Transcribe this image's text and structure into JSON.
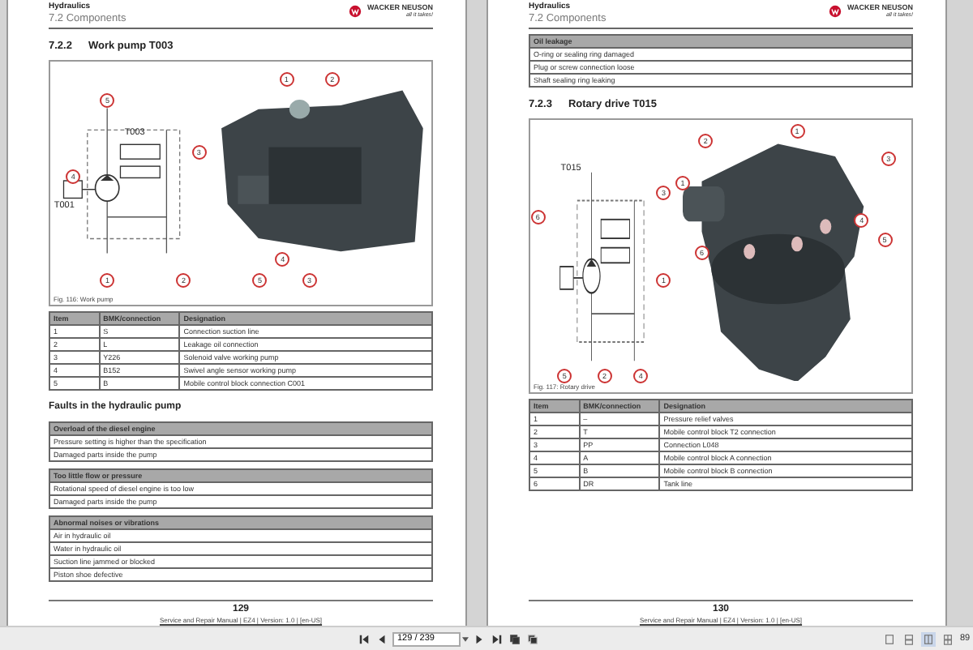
{
  "pages": [
    {
      "running_header": "Hydraulics",
      "section": "7.2 Components",
      "logo": {
        "brand": "WACKER NEUSON",
        "tagline": "all it takes!"
      },
      "blocks": [
        {
          "kind": "heading",
          "number": "7.2.2",
          "title": "Work pump T003"
        },
        {
          "kind": "pump_figure",
          "labels": [
            "T003",
            "T001"
          ],
          "schematic_callouts": [
            "5",
            "3",
            "4",
            "1",
            "2"
          ],
          "photo_callouts": [
            "1",
            "2",
            "4",
            "5",
            "3"
          ],
          "caption": "Fig. 116: Work pump"
        },
        {
          "kind": "parts_table",
          "columns": [
            "Item",
            "BMK/connection",
            "Designation"
          ],
          "rows": [
            [
              "1",
              "S",
              "Connection suction line"
            ],
            [
              "2",
              "L",
              "Leakage oil connection"
            ],
            [
              "3",
              "Y226",
              "Solenoid valve working pump"
            ],
            [
              "4",
              "B152",
              "Swivel angle sensor working pump"
            ],
            [
              "5",
              "B",
              "Mobile control block connection C001"
            ]
          ]
        },
        {
          "kind": "subheading",
          "title": "Faults in the hydraulic pump"
        },
        {
          "kind": "faults",
          "groups": [
            {
              "title": "Overload of the diesel engine",
              "items": [
                "Pressure setting is higher than the specification",
                "Damaged parts inside the pump"
              ]
            },
            {
              "title": "Too little flow or pressure",
              "items": [
                "Rotational speed of diesel engine is too low",
                "Damaged parts inside the pump"
              ]
            },
            {
              "title": "Abnormal noises or vibrations",
              "items": [
                "Air in hydraulic oil",
                "Water in hydraulic oil",
                "Suction line jammed or blocked",
                "Piston shoe defective"
              ]
            }
          ]
        }
      ],
      "page_number": "129",
      "footer": "Service and Repair Manual | EZ4 | Version: 1.0 | [en-US]"
    },
    {
      "running_header": "Hydraulics",
      "section": "7.2 Components",
      "logo": {
        "brand": "WACKER NEUSON",
        "tagline": "all it takes!"
      },
      "blocks": [
        {
          "kind": "faults",
          "groups": [
            {
              "title": "Oil leakage",
              "items": [
                "O-ring or sealing ring damaged",
                "Plug or screw connection loose",
                "Shaft sealing ring leaking"
              ]
            }
          ]
        },
        {
          "kind": "heading",
          "number": "7.2.3",
          "title": "Rotary drive T015"
        },
        {
          "kind": "rotary_figure",
          "labels": [
            "T015"
          ],
          "schematic_callouts": [
            "6",
            "3",
            "1",
            "5",
            "2",
            "4"
          ],
          "photo_callouts": [
            "1",
            "2",
            "1",
            "3",
            "4",
            "5",
            "6"
          ],
          "caption": "Fig. 117: Rotary drive"
        },
        {
          "kind": "parts_table",
          "columns": [
            "Item",
            "BMK/connection",
            "Designation"
          ],
          "rows": [
            [
              "1",
              "–",
              "Pressure relief valves"
            ],
            [
              "2",
              "T",
              "Mobile control block T2 connection"
            ],
            [
              "3",
              "PP",
              "Connection L048"
            ],
            [
              "4",
              "A",
              "Mobile control block A connection"
            ],
            [
              "5",
              "B",
              "Mobile control block B connection"
            ],
            [
              "6",
              "DR",
              "Tank line"
            ]
          ]
        }
      ],
      "page_number": "130",
      "footer": "Service and Repair Manual | EZ4 | Version: 1.0 | [en-US]"
    }
  ],
  "toolbar": {
    "page_field": {
      "value": "129 / 239"
    },
    "view_modes": [
      {
        "selected": false
      },
      {
        "selected": false
      },
      {
        "selected": true
      },
      {
        "selected": false
      }
    ],
    "zoom": "89"
  }
}
